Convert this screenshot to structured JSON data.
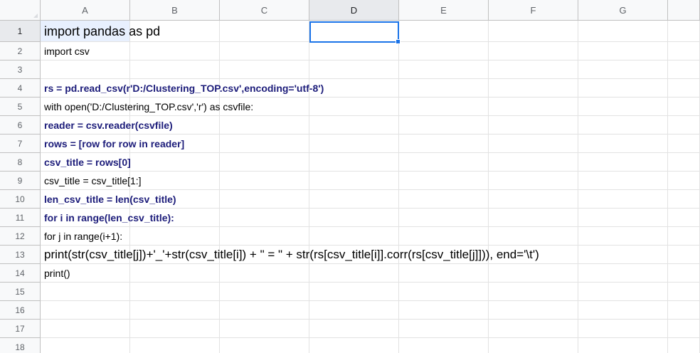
{
  "columns": [
    "A",
    "B",
    "C",
    "D",
    "E",
    "F",
    "G"
  ],
  "selected_column": "D",
  "rows": [
    {
      "num": "1",
      "a": "import pandas as pd"
    },
    {
      "num": "2",
      "a": "import csv"
    },
    {
      "num": "3",
      "a": ""
    },
    {
      "num": "4",
      "a": "rs = pd.read_csv(r'D:/Clustering_TOP.csv',encoding='utf-8')"
    },
    {
      "num": "5",
      "a": "with open('D:/Clustering_TOP.csv','r') as csvfile:"
    },
    {
      "num": "6",
      "a": "reader = csv.reader(csvfile)"
    },
    {
      "num": "7",
      "a": "rows = [row for row in reader]"
    },
    {
      "num": "8",
      "a": "csv_title = rows[0]"
    },
    {
      "num": "9",
      "a": "csv_title = csv_title[1:]"
    },
    {
      "num": "10",
      "a": "len_csv_title = len(csv_title)"
    },
    {
      "num": "11",
      "a": "for i in range(len_csv_title):"
    },
    {
      "num": "12",
      "a": "for j in range(i+1):"
    },
    {
      "num": "13",
      "a": "print(str(csv_title[j])+'_'+str(csv_title[i]) + \" = \" + str(rs[csv_title[i]].corr(rs[csv_title[j]])), end='\\t')"
    },
    {
      "num": "14",
      "a": "print()"
    },
    {
      "num": "15",
      "a": ""
    },
    {
      "num": "16",
      "a": ""
    },
    {
      "num": "17",
      "a": ""
    },
    {
      "num": "18",
      "a": ""
    }
  ],
  "selected_cell": "D1",
  "colors": {
    "header_bg": "#f8f9fa",
    "selected_header_bg": "#e8eaed",
    "selection_border": "#1a73e8",
    "bold_text": "#1c1c7a",
    "gridline": "#e2e2e2"
  }
}
